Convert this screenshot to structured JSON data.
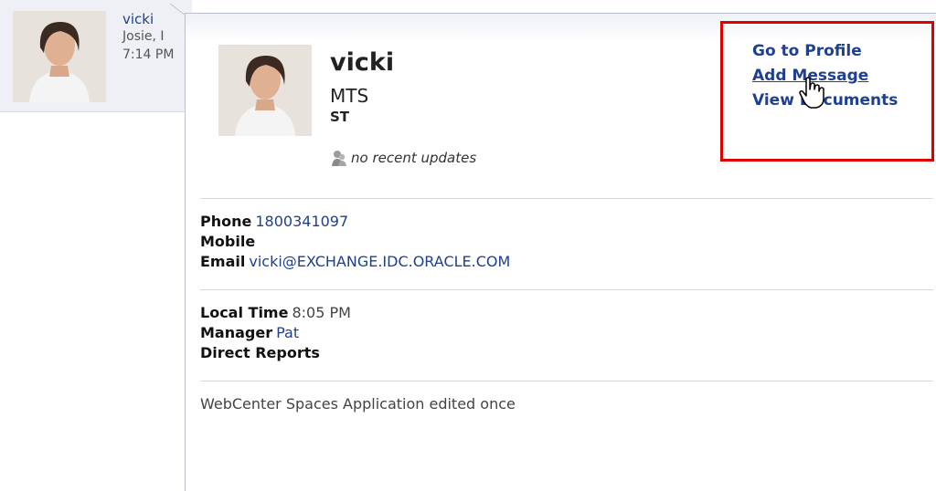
{
  "background_entry": {
    "name": "vicki",
    "line1": "Josie, I",
    "line2": "7:14 PM"
  },
  "profile": {
    "name": "vicki",
    "title": "MTS",
    "org": "ST",
    "status": "no recent updates",
    "avatar_icon": "person-photo-icon",
    "status_icon": "status-person-icon"
  },
  "actions": {
    "go_to_profile": "Go to Profile",
    "add_message": "Add Message",
    "view_documents": "View Documents",
    "highlight_color": "#e00000"
  },
  "contact": {
    "phone_label": "Phone",
    "phone_value": "1800341097",
    "mobile_label": "Mobile",
    "email_label": "Email",
    "email_value": "vicki@EXCHANGE.IDC.ORACLE.COM"
  },
  "org_info": {
    "local_time_label": "Local Time",
    "local_time_value": "8:05 PM",
    "manager_label": "Manager",
    "manager_value": "Pat",
    "direct_reports_label": "Direct Reports"
  },
  "activity": "WebCenter Spaces Application edited once",
  "colors": {
    "link": "#1f3f8f",
    "text": "#222222"
  }
}
